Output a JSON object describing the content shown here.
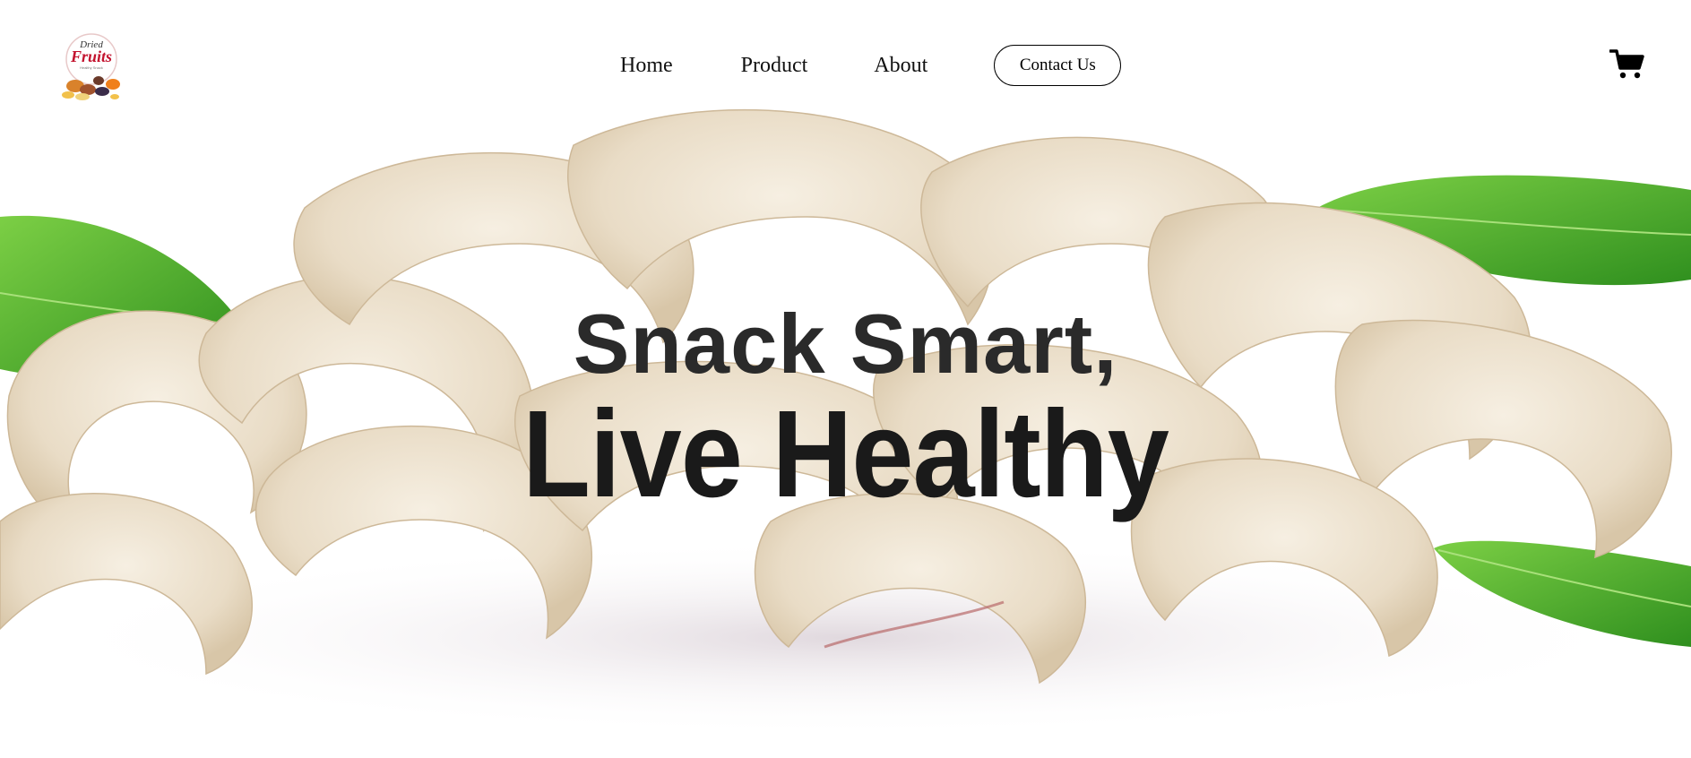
{
  "logo": {
    "line1": "Dried",
    "line2": "Fruits",
    "line3": "Healthy Snack"
  },
  "nav": {
    "home": "Home",
    "product": "Product",
    "about": "About",
    "contact": "Contact Us"
  },
  "hero": {
    "line1": "Snack Smart,",
    "line2": "Live Healthy"
  },
  "colors": {
    "text": "#1a1a1a",
    "cashew": "#efe6d6",
    "leaf": "#4caf2a",
    "background": "#ffffff"
  },
  "icons": [
    "cart-icon",
    "logo-emblem"
  ]
}
